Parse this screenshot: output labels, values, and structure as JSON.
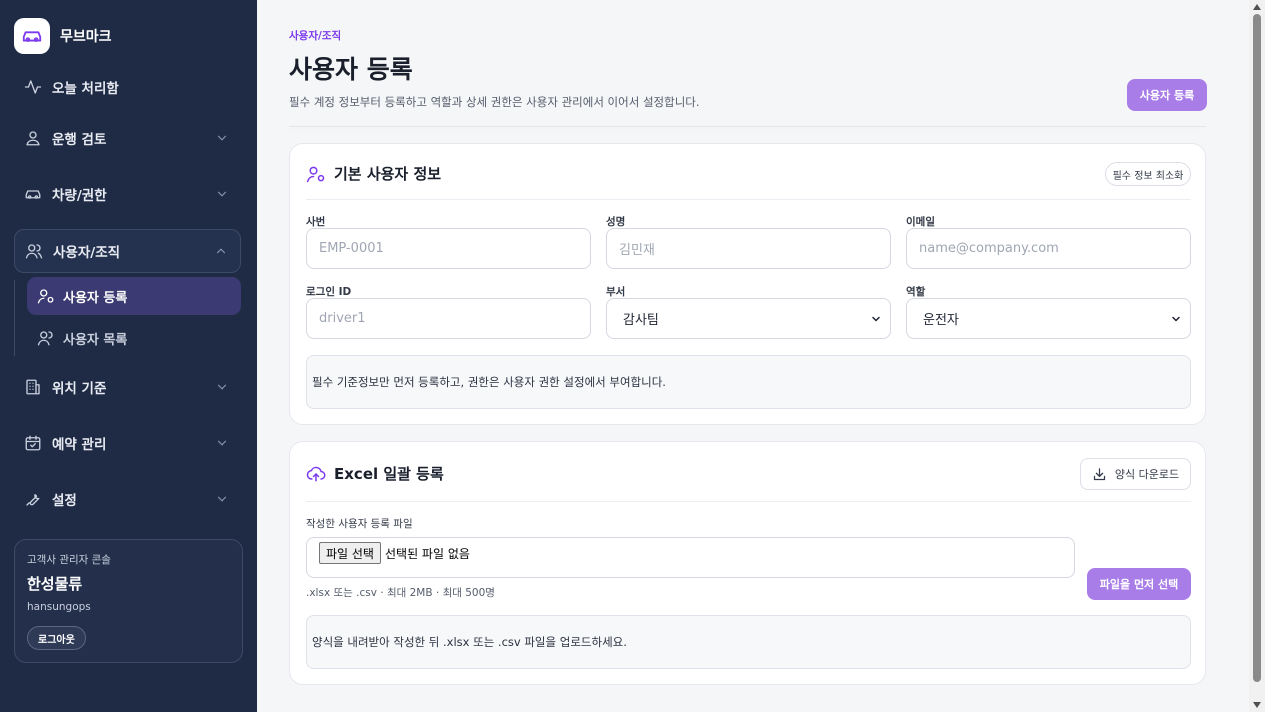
{
  "brand": {
    "name": "무브마크"
  },
  "sidebar": {
    "items": [
      {
        "label": "오늘 처리함"
      },
      {
        "label": "운행 검토"
      },
      {
        "label": "차량/권한"
      },
      {
        "label": "사용자/조직"
      },
      {
        "label": "위치 기준"
      },
      {
        "label": "예약 관리"
      },
      {
        "label": "설정"
      }
    ],
    "sub_items": [
      {
        "label": "사용자 등록"
      },
      {
        "label": "사용자 목록"
      }
    ],
    "account": {
      "caption": "고객사 관리자 콘솔",
      "org": "한성물류",
      "user": "hansungops",
      "logout": "로그아웃"
    }
  },
  "header": {
    "breadcrumb": "사용자/조직",
    "title": "사용자 등록",
    "subtitle": "필수 계정 정보부터 등록하고 역할과 상세 권한은 사용자 관리에서 이어서 설정합니다.",
    "register_button": "사용자 등록"
  },
  "basic": {
    "title": "기본 사용자 정보",
    "minimize_button": "필수 정보 최소화",
    "fields": {
      "emp_label": "사번",
      "emp_placeholder": "EMP-0001",
      "name_label": "성명",
      "name_placeholder": "김민재",
      "email_label": "이메일",
      "email_placeholder": "name@company.com",
      "login_label": "로그인 ID",
      "login_placeholder": "driver1",
      "dept_label": "부서",
      "dept_value": "감사팀",
      "role_label": "역할",
      "role_value": "운전자"
    },
    "note": "필수 기준정보만 먼저 등록하고, 권한은 사용자 권한 설정에서 부여합니다."
  },
  "excel": {
    "title": "Excel 일괄 등록",
    "download_button": "양식 다운로드",
    "file_label": "작성한 사용자 등록 파일",
    "choose_button": "파일 선택",
    "no_file": "선택된 파일 없음",
    "hint": ".xlsx 또는 .csv · 최대 2MB · 최대 500명",
    "submit_button": "파일을 먼저 선택",
    "note": "양식을 내려받아 작성한 뒤 .xlsx 또는 .csv 파일을 업로드하세요."
  },
  "colors": {
    "sidebar_bg": "#1f2b45",
    "accent": "#7c3aed",
    "primary_button": "#a97de8"
  }
}
